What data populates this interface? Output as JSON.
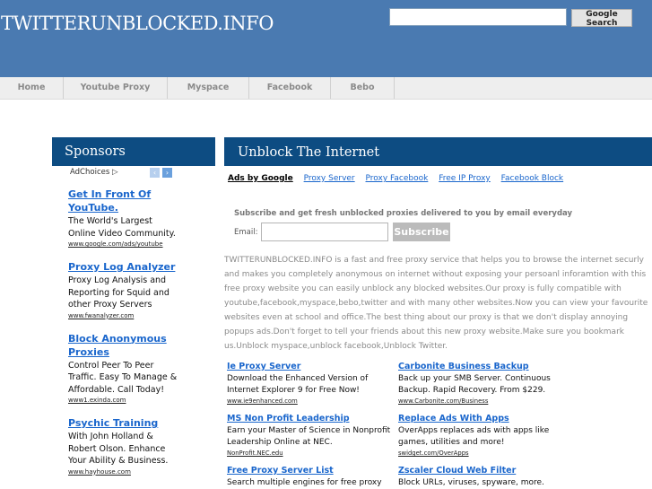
{
  "header": {
    "site_title": "TWITTERUNBLOCKED.INFO",
    "search_placeholder": "",
    "search_button": "Google Search"
  },
  "nav": [
    "Home",
    "Youtube Proxy",
    "Myspace",
    "Facebook",
    "Bebo"
  ],
  "sidebar": {
    "title": "Sponsors",
    "adchoices": "AdChoices ▷",
    "ads": [
      {
        "title": "Get In Front Of YouTube.",
        "body": "The World's Largest Online Video Community.",
        "url": "www.google.com/ads/youtube"
      },
      {
        "title": "Proxy Log Analyzer",
        "body": "Proxy Log Analysis and Reporting for Squid and other Proxy Servers",
        "url": "www.fwanalyzer.com"
      },
      {
        "title": "Block Anonymous Proxies",
        "body": "Control Peer To Peer Traffic. Easy To Manage & Affordable. Call Today!",
        "url": "www1.exinda.com"
      },
      {
        "title": "Psychic Training",
        "body": "With John Holland & Robert Olson. Enhance Your Ability & Business.",
        "url": "www.hayhouse.com"
      }
    ]
  },
  "main": {
    "title": "Unblock The Internet",
    "ads_by": "Ads by Google",
    "ad_links": [
      "Proxy Server",
      "Proxy Facebook",
      "Free IP Proxy",
      "Facebook Block"
    ],
    "subscribe_text": "Subscribe and get fresh unblocked proxies delivered to you by email everyday",
    "email_label": "Email:",
    "email_value": "",
    "subscribe_button": "Subscribe",
    "description": "TWITTERUNBLOCKED.INFO is a fast and free proxy service that helps you to browse the internet securly and makes you completely anonymous on internet without exposing your persoanl inforamtion with this free proxy website you can easily unblock any blocked websites.Our proxy is fully compatible with youtube,facebook,myspace,bebo,twitter and with many other websites.Now you can view your favourite websites even at school and office.The best thing about our proxy is that we don't display annoying popups ads.Don't forget to tell your friends about this new proxy website.Make sure you bookmark us.Unblock myspace,unblock facebook,Unblock Twitter.",
    "ads": [
      {
        "title": "Ie Proxy Server",
        "body": "Download the Enhanced Version of Internet Explorer 9 for Free Now!",
        "url": "www.ie9enhanced.com"
      },
      {
        "title": "Carbonite Business Backup",
        "body": "Back up your SMB Server. Continuous Backup. Rapid Recovery. From $229.",
        "url": "www.Carbonite.com/Business"
      },
      {
        "title": "MS Non Profit Leadership",
        "body": "Earn your Master of Science in Nonprofit Leadership Online at NEC.",
        "url": "NonProfit.NEC.edu"
      },
      {
        "title": "Replace Ads With Apps",
        "body": "OverApps replaces ads with apps like games, utilities and more!",
        "url": "swidget.com/OverApps"
      },
      {
        "title": "Free Proxy Server List",
        "body": "Search multiple engines for free proxy",
        "url": ""
      },
      {
        "title": "Zscaler Cloud Web Filter",
        "body": "Block URLs, viruses, spyware, more.",
        "url": ""
      }
    ]
  }
}
